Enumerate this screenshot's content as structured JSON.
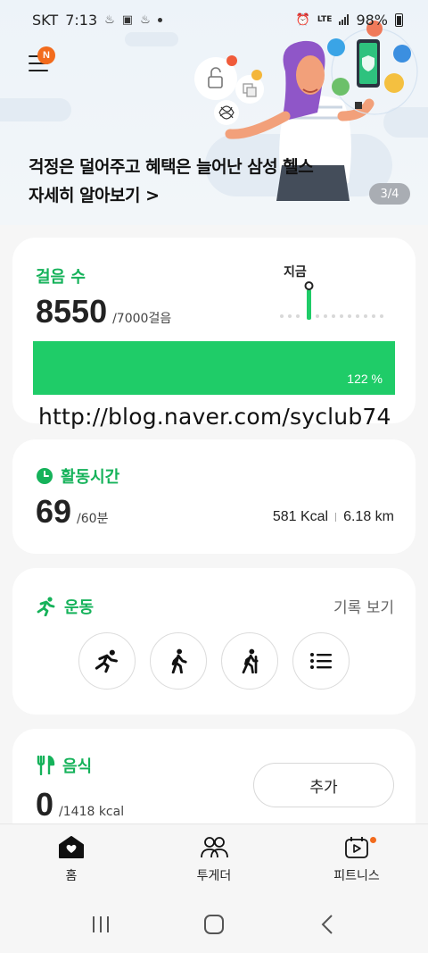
{
  "status_bar": {
    "carrier": "SKT",
    "time": "7:13",
    "network": "LTE",
    "battery": "98%"
  },
  "banner": {
    "menu_badge": "N",
    "line1": "걱정은 덜어주고 혜택은 늘어난 삼성 헬스",
    "line2": "자세히 알아보기 >",
    "page_indicator": "3/4"
  },
  "steps": {
    "title": "걸음 수",
    "value": "8550",
    "goal": "/7000걸음",
    "now_label": "지금",
    "progress_text": "122 %",
    "progress_fraction": 1.0
  },
  "watermark": "http://blog.naver.com/syclub74",
  "active_time": {
    "title": "활동시간",
    "value": "69",
    "goal": "/60분",
    "calories": "581 Kcal",
    "distance": "6.18 km"
  },
  "exercise": {
    "title": "운동",
    "records_link": "기록 보기",
    "buttons": [
      "running-icon",
      "walking-icon",
      "hiking-icon",
      "list-icon"
    ]
  },
  "food": {
    "title": "음식",
    "value": "0",
    "goal": "/1418 kcal",
    "add_label": "추가"
  },
  "bottom_nav": {
    "home": "홈",
    "together": "투게더",
    "fitness": "피트니스"
  },
  "colors": {
    "accent_green": "#15b25a",
    "progress_green": "#1fcc68",
    "badge_orange": "#f26b1d"
  }
}
